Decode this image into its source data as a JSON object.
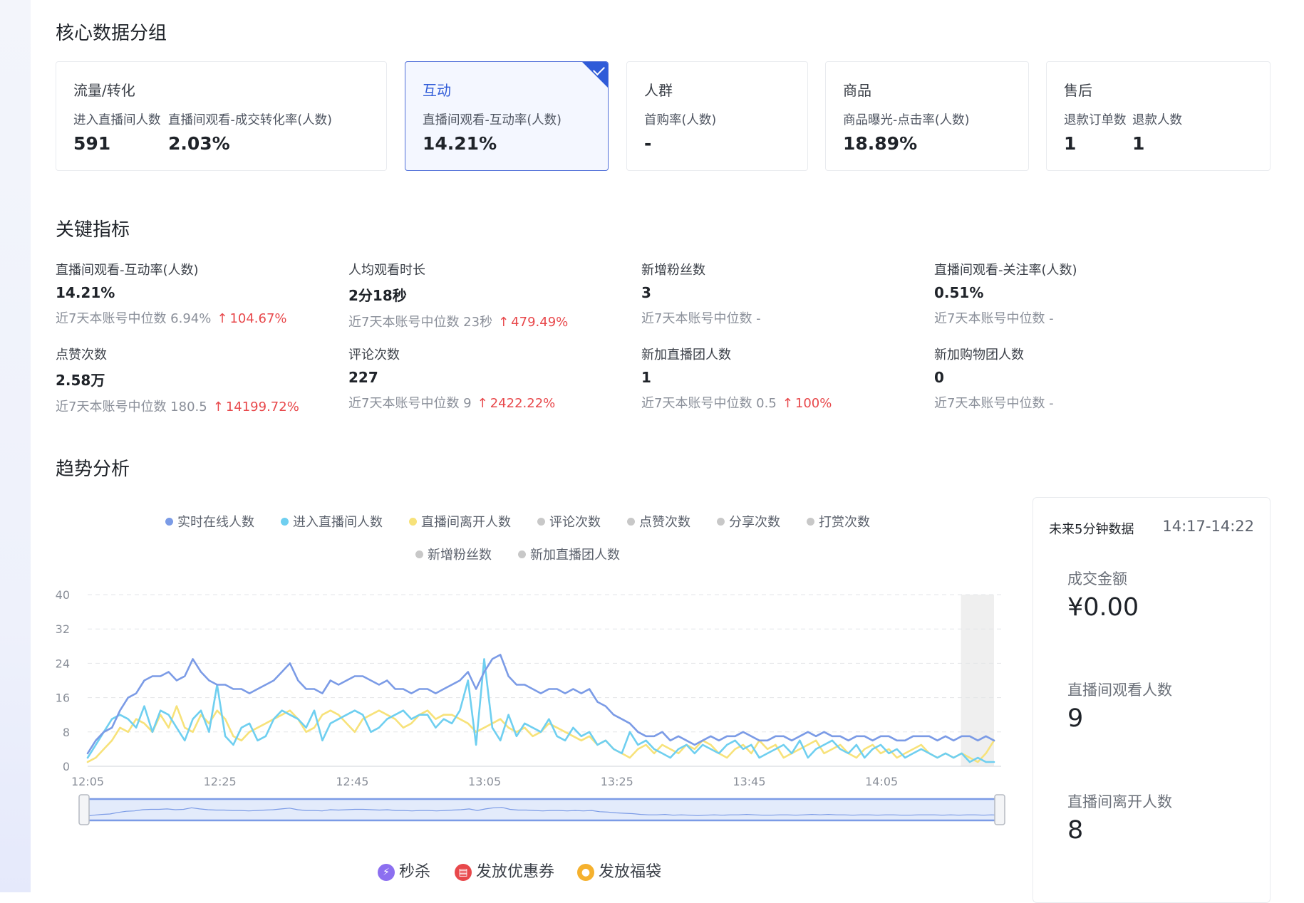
{
  "core_group": {
    "title": "核心数据分组",
    "cards": [
      {
        "title": "流量/转化",
        "metrics": [
          {
            "label": "进入直播间人数",
            "value": "591"
          },
          {
            "label": "直播间观看-成交转化率(人数)",
            "value": "2.03%"
          }
        ]
      },
      {
        "title": "互动",
        "selected": true,
        "metrics": [
          {
            "label": "直播间观看-互动率(人数)",
            "value": "14.21%"
          }
        ]
      },
      {
        "title": "人群",
        "metrics": [
          {
            "label": "首购率(人数)",
            "value": "-"
          }
        ]
      },
      {
        "title": "商品",
        "metrics": [
          {
            "label": "商品曝光-点击率(人数)",
            "value": "18.89%"
          }
        ]
      },
      {
        "title": "售后",
        "metrics": [
          {
            "label": "退款订单数",
            "value": "1"
          },
          {
            "label": "退款人数",
            "value": "1"
          }
        ]
      }
    ]
  },
  "key_metrics": {
    "title": "关键指标",
    "items": [
      {
        "label": "直播间观看-互动率(人数)",
        "value": "14.21%",
        "compare": "近7天本账号中位数 6.94%",
        "change": "104.67%"
      },
      {
        "label": "人均观看时长",
        "value": "2分18秒",
        "compare": "近7天本账号中位数 23秒",
        "change": "479.49%"
      },
      {
        "label": "新增粉丝数",
        "value": "3",
        "compare": "近7天本账号中位数 -",
        "change": ""
      },
      {
        "label": "直播间观看-关注率(人数)",
        "value": "0.51%",
        "compare": "近7天本账号中位数 -",
        "change": ""
      },
      {
        "label": "点赞次数",
        "value": "2.58万",
        "compare": "近7天本账号中位数 180.5",
        "change": "14199.72%"
      },
      {
        "label": "评论次数",
        "value": "227",
        "compare": "近7天本账号中位数 9",
        "change": "2422.22%"
      },
      {
        "label": "新加直播团人数",
        "value": "1",
        "compare": "近7天本账号中位数 0.5",
        "change": "100%"
      },
      {
        "label": "新加购物团人数",
        "value": "0",
        "compare": "近7天本账号中位数 -",
        "change": ""
      }
    ]
  },
  "trend": {
    "title": "趋势分析",
    "legend": [
      {
        "label": "实时在线人数",
        "color": "#7b9be6"
      },
      {
        "label": "进入直播间人数",
        "color": "#6fcff0"
      },
      {
        "label": "直播间离开人数",
        "color": "#f7e27a"
      },
      {
        "label": "评论次数",
        "color": "#c8c8c8"
      },
      {
        "label": "点赞次数",
        "color": "#c8c8c8"
      },
      {
        "label": "分享次数",
        "color": "#c8c8c8"
      },
      {
        "label": "打赏次数",
        "color": "#c8c8c8"
      },
      {
        "label": "新增粉丝数",
        "color": "#c8c8c8"
      },
      {
        "label": "新加直播团人数",
        "color": "#c8c8c8"
      }
    ],
    "markers": [
      {
        "label": "秒杀",
        "icon": "lightning-icon",
        "color": "#8c6ff0"
      },
      {
        "label": "发放优惠券",
        "icon": "coupon-icon",
        "color": "#e8484b"
      },
      {
        "label": "发放福袋",
        "icon": "lucky-bag-icon",
        "color": "#f5b12e"
      }
    ]
  },
  "chart_data": {
    "type": "line",
    "x_ticks": [
      "12:05",
      "12:25",
      "12:45",
      "13:05",
      "13:25",
      "13:45",
      "14:05"
    ],
    "x_range": [
      "12:05",
      "14:22"
    ],
    "ylim": [
      0,
      40
    ],
    "y_ticks": [
      0,
      8,
      16,
      24,
      32,
      40
    ],
    "grid": true,
    "series": [
      {
        "name": "实时在线人数",
        "color": "#7b9be6",
        "values": [
          3,
          6,
          8,
          9,
          13,
          16,
          17,
          20,
          21,
          21,
          22,
          20,
          21,
          25,
          22,
          20,
          19,
          19,
          18,
          18,
          17,
          18,
          19,
          20,
          22,
          24,
          20,
          18,
          18,
          17,
          20,
          19,
          20,
          21,
          21,
          20,
          19,
          20,
          18,
          18,
          17,
          18,
          18,
          17,
          18,
          19,
          20,
          22,
          18,
          22,
          25,
          26,
          21,
          19,
          19,
          18,
          17,
          18,
          18,
          17,
          18,
          17,
          18,
          15,
          14,
          12,
          11,
          10,
          8,
          7,
          7,
          8,
          6,
          7,
          6,
          5,
          6,
          7,
          6,
          7,
          7,
          8,
          7,
          6,
          6,
          7,
          7,
          6,
          7,
          8,
          7,
          8,
          7,
          7,
          6,
          7,
          7,
          6,
          7,
          7,
          6,
          6,
          7,
          7,
          7,
          6,
          7,
          6,
          7,
          7,
          6,
          7,
          6
        ]
      },
      {
        "name": "进入直播间人数",
        "color": "#6fcff0",
        "values": [
          2,
          5,
          8,
          11,
          12,
          11,
          9,
          14,
          8,
          13,
          12,
          9,
          6,
          11,
          13,
          8,
          19,
          7,
          5,
          9,
          10,
          6,
          7,
          11,
          13,
          12,
          11,
          9,
          13,
          6,
          10,
          11,
          12,
          13,
          12,
          8,
          9,
          11,
          12,
          13,
          11,
          12,
          12,
          9,
          11,
          10,
          13,
          20,
          5,
          25,
          9,
          6,
          12,
          7,
          10,
          9,
          8,
          11,
          7,
          6,
          9,
          7,
          8,
          5,
          6,
          4,
          3,
          8,
          5,
          6,
          4,
          3,
          2,
          4,
          5,
          3,
          5,
          4,
          3,
          5,
          6,
          4,
          5,
          2,
          3,
          4,
          5,
          3,
          6,
          2,
          4,
          5,
          6,
          4,
          3,
          5,
          2,
          4,
          5,
          3,
          4,
          2,
          3,
          4,
          3,
          2,
          3,
          2,
          3,
          1,
          2,
          1,
          1
        ]
      },
      {
        "name": "直播间离开人数",
        "color": "#f7e27a",
        "values": [
          1,
          2,
          4,
          6,
          9,
          8,
          11,
          10,
          8,
          12,
          9,
          14,
          9,
          8,
          12,
          10,
          13,
          11,
          7,
          6,
          8,
          9,
          10,
          11,
          12,
          13,
          11,
          8,
          9,
          12,
          13,
          12,
          10,
          8,
          11,
          12,
          13,
          12,
          11,
          9,
          10,
          12,
          13,
          11,
          12,
          12,
          11,
          10,
          8,
          9,
          10,
          11,
          9,
          8,
          9,
          7,
          8,
          10,
          9,
          8,
          7,
          6,
          7,
          5,
          6,
          4,
          3,
          2,
          4,
          5,
          3,
          5,
          4,
          3,
          5,
          4,
          6,
          5,
          3,
          2,
          4,
          5,
          3,
          6,
          4,
          5,
          2,
          3,
          4,
          5,
          6,
          3,
          4,
          5,
          3,
          2,
          4,
          5,
          3,
          4,
          2,
          3,
          4,
          5,
          3,
          2,
          3,
          2,
          3,
          2,
          1,
          3,
          6
        ]
      }
    ]
  },
  "forecast": {
    "title": "未来5分钟数据",
    "range": "14:17-14:22",
    "items": [
      {
        "label": "成交金额",
        "value": "¥0.00"
      },
      {
        "label": "直播间观看人数",
        "value": "9"
      },
      {
        "label": "直播间离开人数",
        "value": "8"
      }
    ]
  }
}
